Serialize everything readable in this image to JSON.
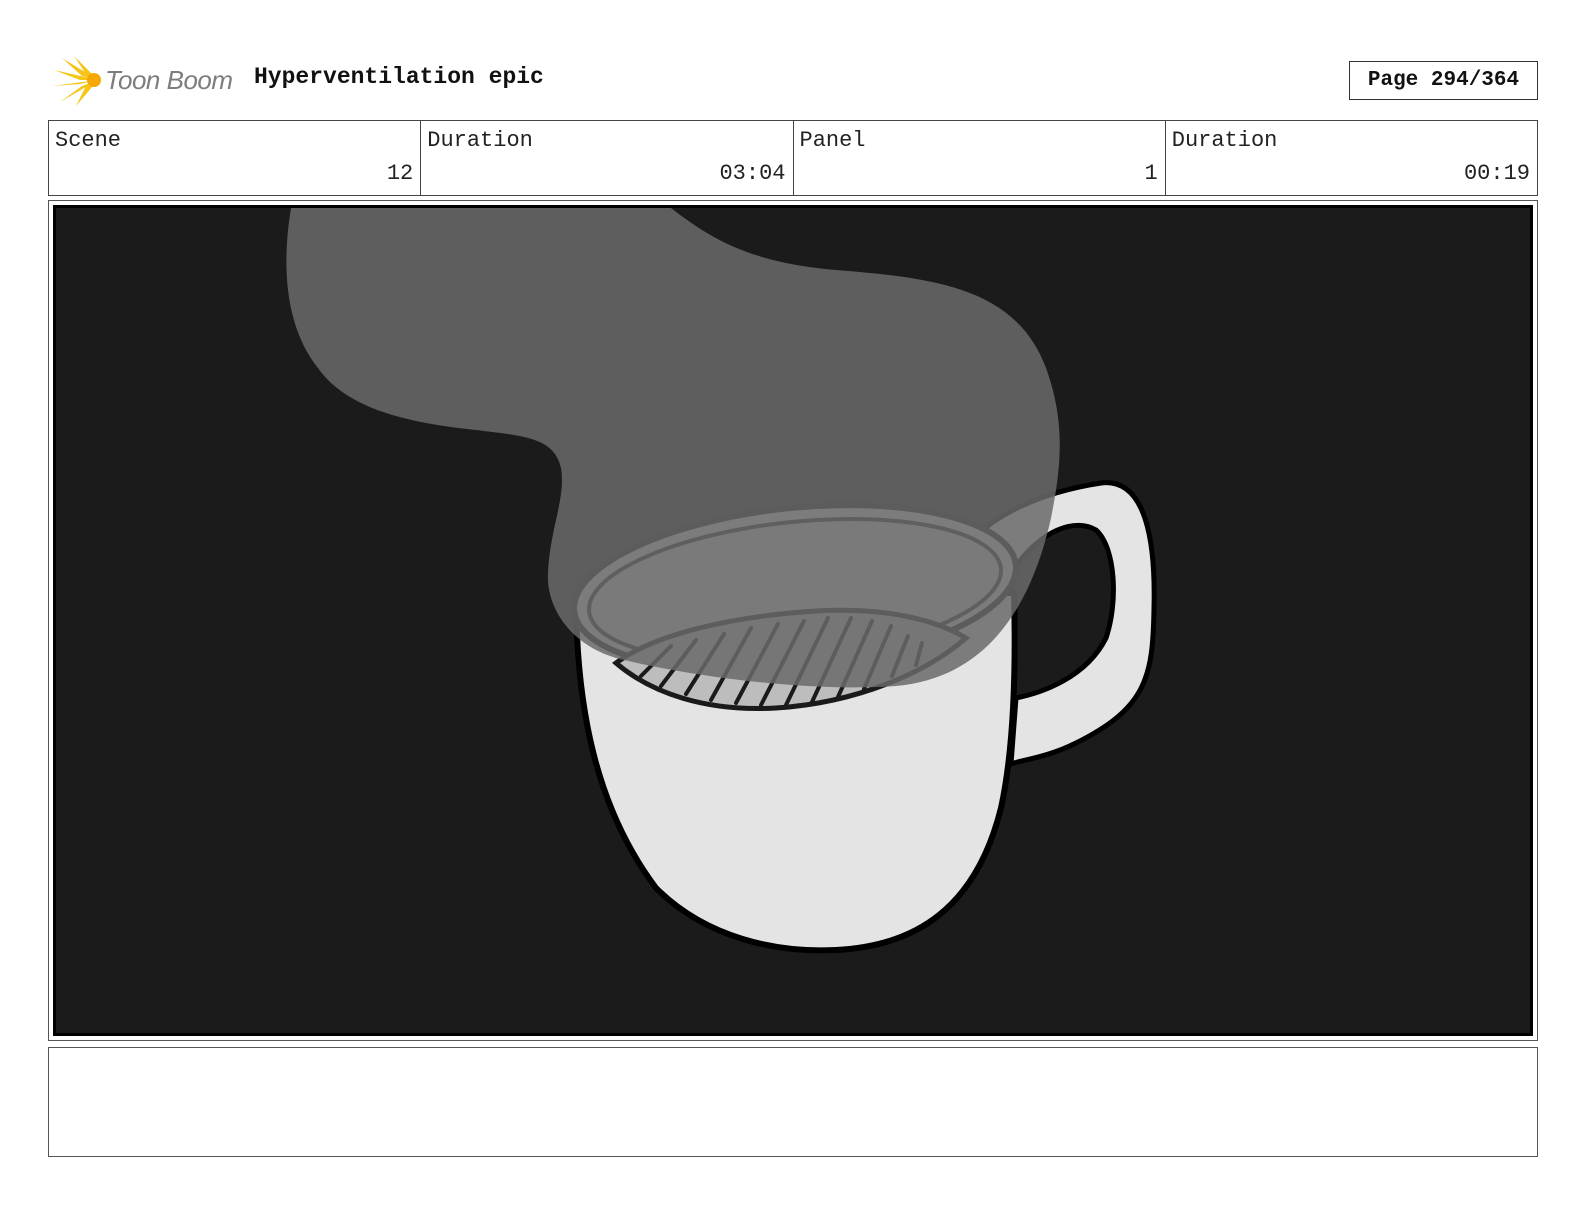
{
  "header": {
    "logo_text": "Toon Boom",
    "title": "Hyperventilation epic",
    "page_label": "Page 294/364"
  },
  "info": [
    {
      "label": "Scene",
      "value": "12"
    },
    {
      "label": "Duration",
      "value": "03:04"
    },
    {
      "label": "Panel",
      "value": "1"
    },
    {
      "label": "Duration",
      "value": "00:19"
    }
  ],
  "panel": {
    "background_color": "#1b1b1b",
    "steam_color": "#5c5c5c",
    "cup_color": "#e4e4e4"
  },
  "notes": {
    "text": ""
  }
}
